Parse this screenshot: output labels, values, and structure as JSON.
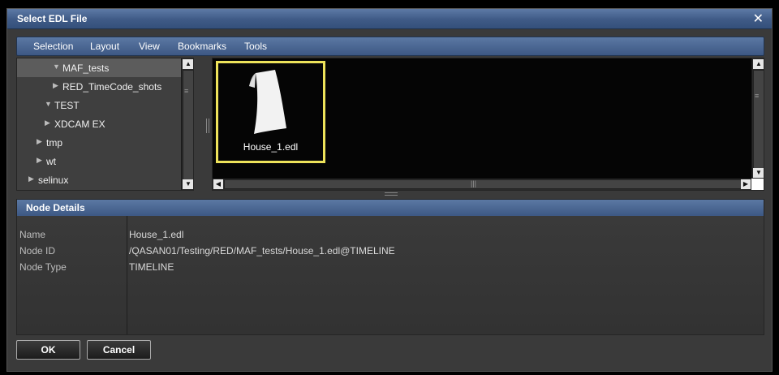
{
  "dialog": {
    "title": "Select EDL File",
    "close_glyph": "✕"
  },
  "menu": [
    "Selection",
    "Layout",
    "View",
    "Bookmarks",
    "Tools"
  ],
  "tree": [
    {
      "label": "MAF_tests",
      "expanded": true,
      "selected": true
    },
    {
      "label": "RED_TimeCode_shots",
      "expanded": false,
      "selected": false
    },
    {
      "label": "TEST",
      "expanded": true,
      "selected": false
    },
    {
      "label": "XDCAM EX",
      "expanded": false,
      "selected": false
    },
    {
      "label": "tmp",
      "expanded": false,
      "selected": false
    },
    {
      "label": "wt",
      "expanded": false,
      "selected": false
    },
    {
      "label": "selinux",
      "expanded": false,
      "selected": false
    }
  ],
  "browser": {
    "files": [
      {
        "name": "House_1.edl",
        "icon": "document-icon",
        "selected": true
      }
    ],
    "highlight_color": "#ede25a"
  },
  "details": {
    "title": "Node Details",
    "rows": [
      {
        "name": "Name",
        "value": "House_1.edl"
      },
      {
        "name": "Node ID",
        "value": "/QASAN01/Testing/RED/MAF_tests/House_1.edl@TIMELINE"
      },
      {
        "name": "Node Type",
        "value": "TIMELINE"
      }
    ]
  },
  "buttons": {
    "ok": "OK",
    "cancel": "Cancel"
  }
}
